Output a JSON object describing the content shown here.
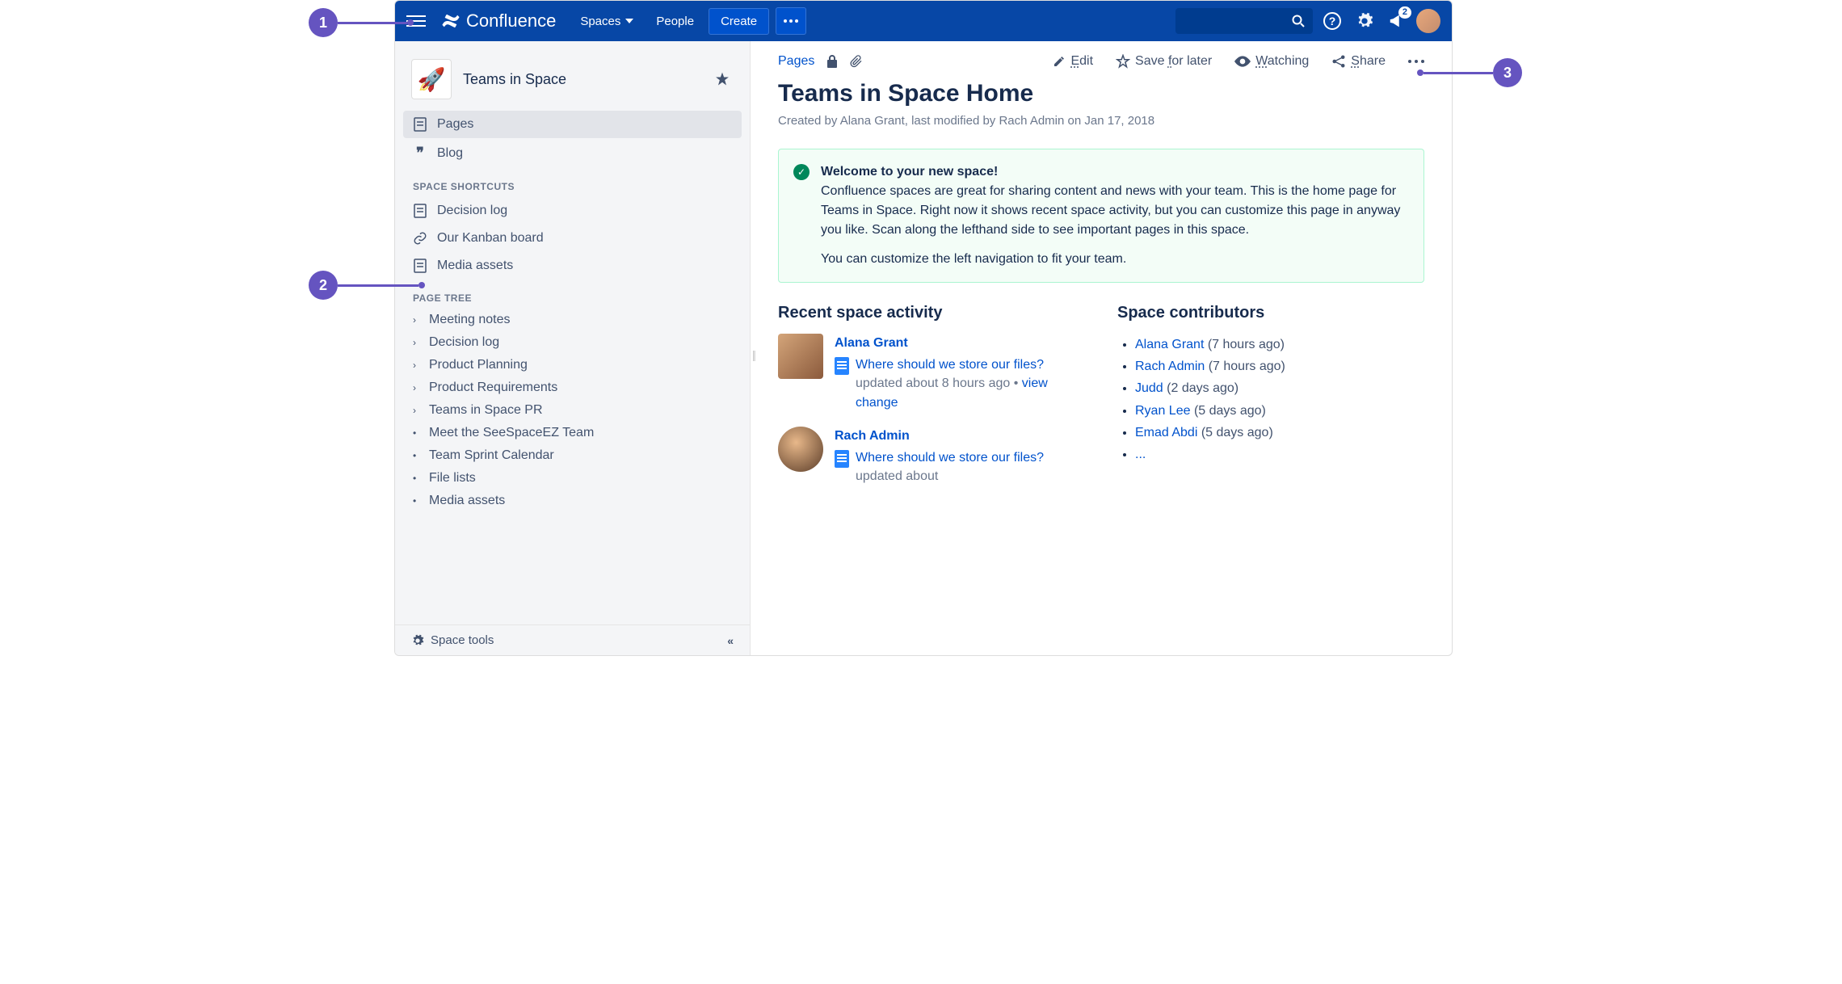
{
  "annotations": {
    "c1": "1",
    "c2": "2",
    "c3": "3"
  },
  "topnav": {
    "brand": "Confluence",
    "spaces": "Spaces",
    "people": "People",
    "create": "Create",
    "notification_count": "2"
  },
  "sidebar": {
    "space_name": "Teams in Space",
    "pages": "Pages",
    "blog": "Blog",
    "shortcuts_heading": "SPACE SHORTCUTS",
    "shortcuts": [
      {
        "label": "Decision log",
        "icon": "page"
      },
      {
        "label": "Our Kanban board",
        "icon": "link"
      },
      {
        "label": "Media assets",
        "icon": "page"
      }
    ],
    "tree_heading": "PAGE TREE",
    "tree": [
      {
        "label": "Meeting notes",
        "expandable": true
      },
      {
        "label": "Decision log",
        "expandable": true
      },
      {
        "label": "Product Planning",
        "expandable": true
      },
      {
        "label": "Product Requirements",
        "expandable": true
      },
      {
        "label": "Teams in Space PR",
        "expandable": true
      },
      {
        "label": "Meet the SeeSpaceEZ Team",
        "expandable": false
      },
      {
        "label": "Team Sprint Calendar",
        "expandable": false
      },
      {
        "label": "File lists",
        "expandable": false
      },
      {
        "label": "Media assets",
        "expandable": false
      }
    ],
    "footer_tools": "Space tools"
  },
  "page": {
    "breadcrumb": "Pages",
    "edit": "Edit",
    "save": "Save for later",
    "watching": "Watching",
    "share": "Share",
    "title": "Teams in Space Home",
    "byline": "Created by Alana Grant, last modified by Rach Admin on Jan 17, 2018",
    "panel_title": "Welcome to your new space!",
    "panel_body": "Confluence spaces are great for sharing content and news with your team. This is the home page for Teams in Space. Right now it shows recent space activity, but you can customize this page in anyway you like. Scan along the lefthand side to see important pages in this space.",
    "panel_body2": "You can customize the left navigation to fit your team.",
    "recent_heading": "Recent space activity",
    "contrib_heading": "Space contributors",
    "activity": [
      {
        "user": "Alana Grant",
        "link": "Where should we store our files?",
        "meta": "updated about 8 hours ago",
        "action": "view change"
      },
      {
        "user": "Rach Admin",
        "link": "Where should we store our files?",
        "meta": "updated about"
      }
    ],
    "contributors": [
      {
        "name": "Alana Grant",
        "meta": "(7 hours ago)"
      },
      {
        "name": "Rach Admin",
        "meta": "(7 hours ago)"
      },
      {
        "name": "Judd",
        "meta": "(2 days ago)"
      },
      {
        "name": "Ryan Lee",
        "meta": "(5 days ago)"
      },
      {
        "name": "Emad Abdi",
        "meta": "(5 days ago)"
      }
    ],
    "contrib_more": "..."
  }
}
